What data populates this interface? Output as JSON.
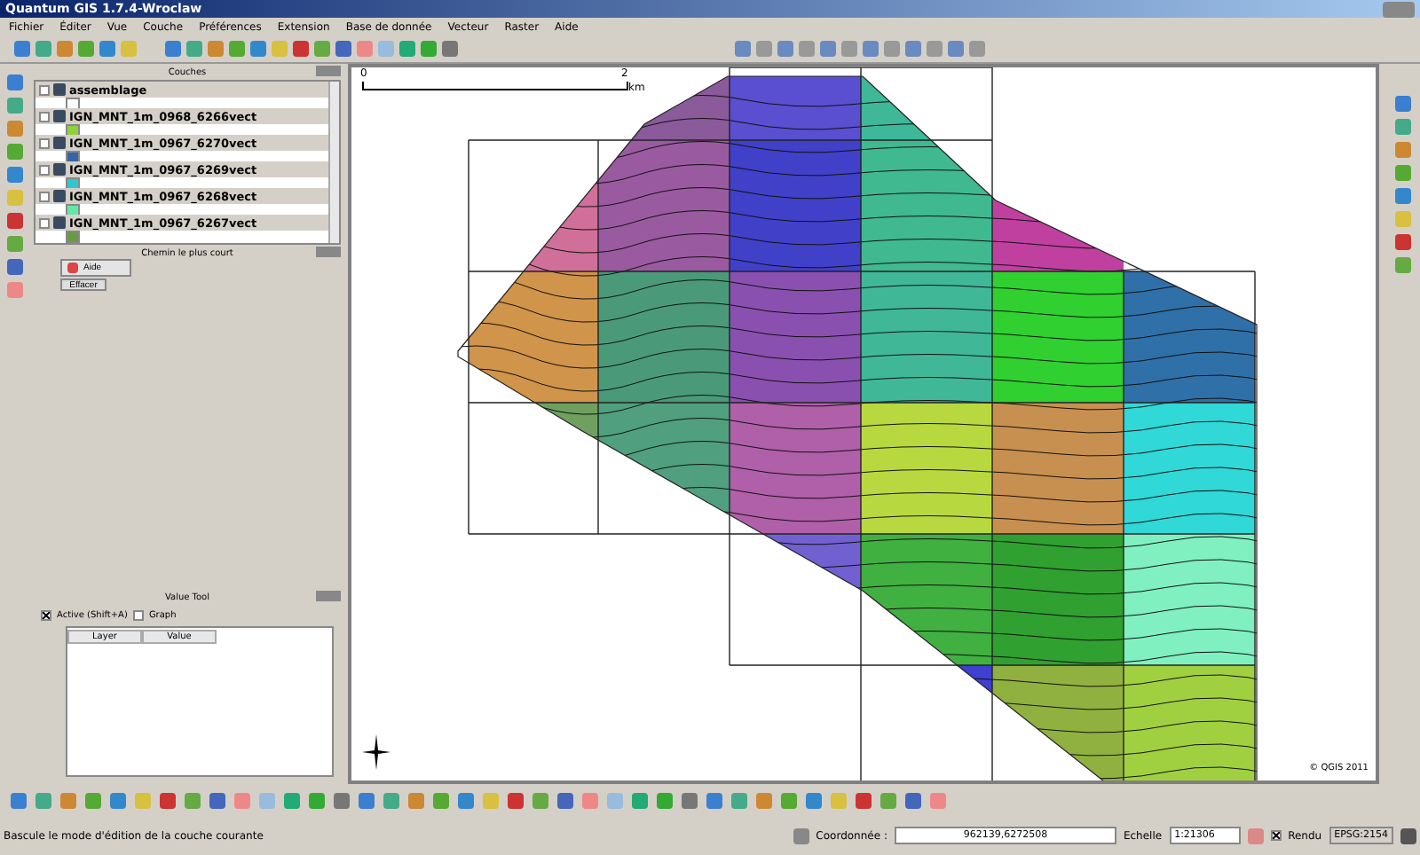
{
  "window": {
    "title": "Quantum GIS 1.7.4-Wroclaw"
  },
  "menu": [
    "Fichier",
    "Éditer",
    "Vue",
    "Couche",
    "Préférences",
    "Extension",
    "Base de donnée",
    "Vecteur",
    "Raster",
    "Aide"
  ],
  "layers_panel": {
    "title": "Couches",
    "layers": [
      {
        "name": "assemblage",
        "visible": false,
        "color": "#ffffff",
        "selected": false
      },
      {
        "name": "IGN_MNT_1m_0968_6266vect",
        "visible": false,
        "color": "#8fd13a",
        "selected": false
      },
      {
        "name": "IGN_MNT_1m_0967_6270vect",
        "visible": false,
        "color": "#3565a5",
        "selected": false
      },
      {
        "name": "IGN_MNT_1m_0967_6269vect",
        "visible": false,
        "color": "#30c6d0",
        "selected": false
      },
      {
        "name": "IGN_MNT_1m_0967_6268vect",
        "visible": false,
        "color": "#66e6a6",
        "selected": false
      },
      {
        "name": "IGN_MNT_1m_0967_6267vect",
        "visible": false,
        "color": "#6a9a40",
        "selected": false
      }
    ]
  },
  "shortest_path_panel": {
    "title": "Chemin le plus court",
    "buttons": [
      "Aide",
      "Effacer"
    ]
  },
  "value_tool": {
    "title": "Value Tool",
    "active": {
      "label": "Active (Shift+A)",
      "checked": true
    },
    "graph": {
      "label": "Graph",
      "checked": false
    },
    "columns": [
      "Layer",
      "Value"
    ]
  },
  "map": {
    "scale_bar": {
      "start": "0",
      "end": "2",
      "unit": "km"
    },
    "copyright": "© QGIS 2011"
  },
  "status_bar": {
    "message": "Bascule le mode d'édition de la couche courante",
    "coordinate_label": "Coordonnée :",
    "coordinate": "962139,6272508",
    "scale_label": "Echelle",
    "scale": "1:21306",
    "render": {
      "label": "Rendu",
      "checked": true
    },
    "crs": "EPSG:2154"
  }
}
